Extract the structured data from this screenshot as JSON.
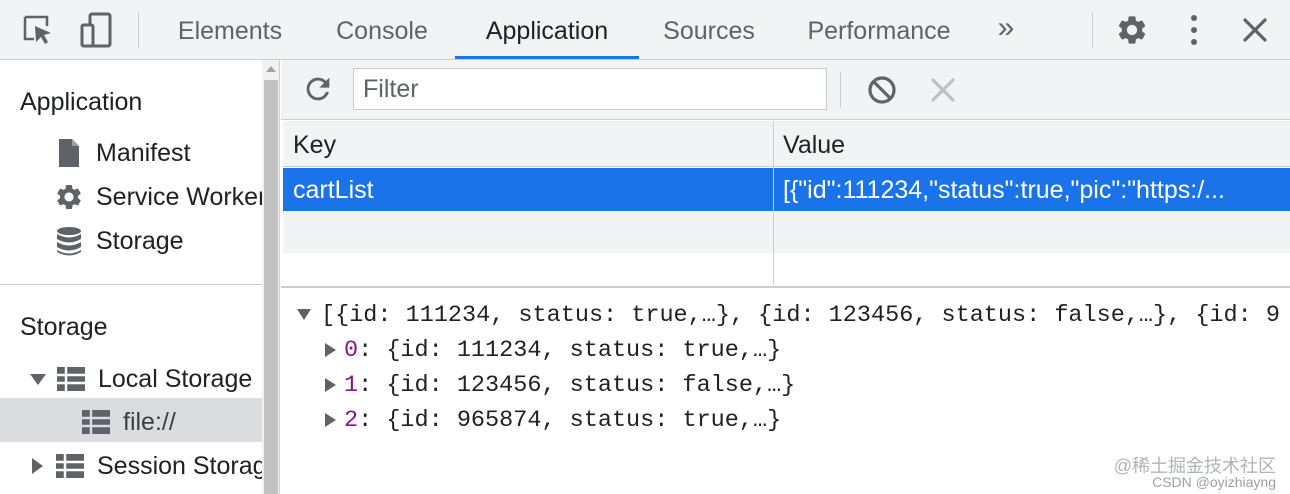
{
  "topbar": {
    "tabs": [
      {
        "label": "Elements",
        "active": false
      },
      {
        "label": "Console",
        "active": false
      },
      {
        "label": "Application",
        "active": true
      },
      {
        "label": "Sources",
        "active": false
      },
      {
        "label": "Performance",
        "active": false
      }
    ],
    "more_label": "»",
    "icons": [
      "inspect-element-icon",
      "device-toolbar-icon",
      "more-tabs-icon",
      "settings-gear-icon",
      "kebab-menu-icon",
      "close-icon"
    ]
  },
  "sidebar": {
    "app_section": "Application",
    "app_items": [
      {
        "label": "Manifest",
        "icon": "manifest-file-icon"
      },
      {
        "label": "Service Workers",
        "icon": "service-worker-gear-icon"
      },
      {
        "label": "Storage",
        "icon": "storage-database-icon"
      }
    ],
    "storage_section": "Storage",
    "storage_items": [
      {
        "label": "Local Storage",
        "expanded": true,
        "icon": "table-grid-icon"
      },
      {
        "label": "file://",
        "selected": true,
        "icon": "table-grid-icon"
      },
      {
        "label": "Session Storage",
        "expanded": false,
        "icon": "table-grid-icon"
      }
    ]
  },
  "toolbar": {
    "filter_placeholder": "Filter",
    "icons": [
      "refresh-icon",
      "clear-all-icon",
      "delete-selected-icon"
    ]
  },
  "grid": {
    "columns": [
      "Key",
      "Value"
    ],
    "rows": [
      {
        "key": "cartList",
        "value": "[{\"id\":111234,\"status\":true,\"pic\":\"https:/...",
        "selected": true
      }
    ]
  },
  "preview": {
    "root": "[{id: 111234, status: true,…}, {id: 123456, status: false,…}, {id: 9",
    "items": [
      {
        "index": "0",
        "value": ": {id: 111234, status: true,…}"
      },
      {
        "index": "1",
        "value": ": {id: 123456, status: false,…}"
      },
      {
        "index": "2",
        "value": ": {id: 965874, status: true,…}"
      }
    ]
  },
  "watermark": {
    "main": "@稀土掘金技术社区",
    "sub": "CSDN @oyizhiayng"
  },
  "colors": {
    "accent": "#1a73e8",
    "toolbar_bg": "#f1f3f4",
    "border": "#cacdd1",
    "index_purple": "#881391"
  }
}
